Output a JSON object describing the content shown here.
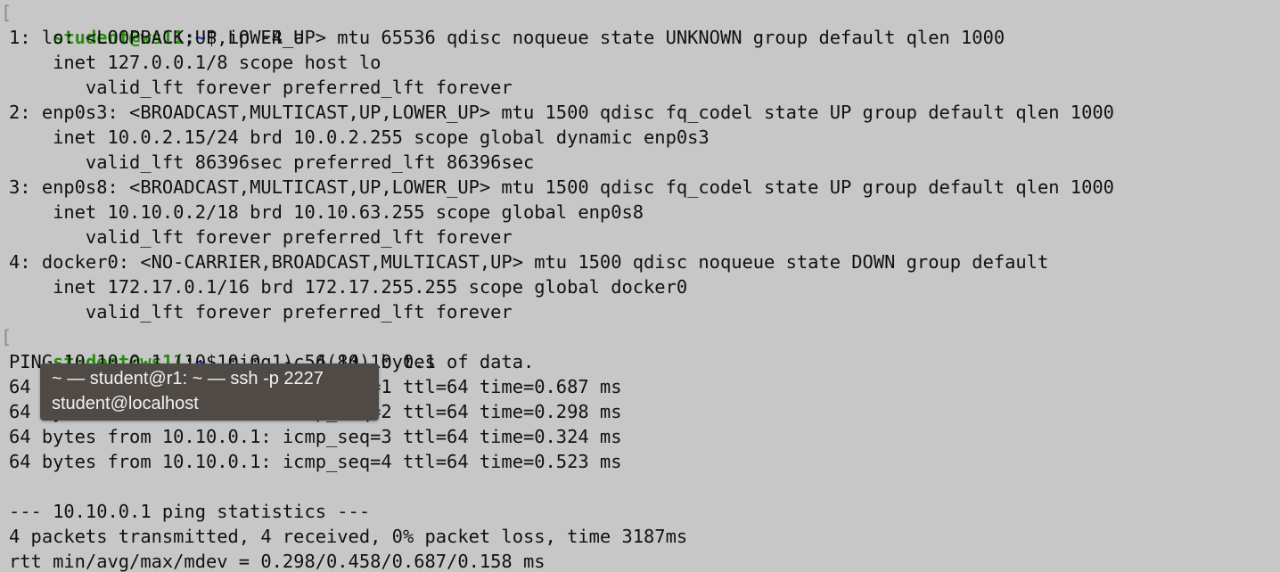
{
  "prompt": {
    "bracket": "[",
    "user": "student@ws11",
    "sep": ":",
    "path": "~",
    "dollar": "$"
  },
  "commands": {
    "first": "ip -4 a",
    "second": "ping -c 4 10.10.0.1"
  },
  "ip_output": [
    "1: lo: <LOOPBACK,UP,LOWER_UP> mtu 65536 qdisc noqueue state UNKNOWN group default qlen 1000",
    "    inet 127.0.0.1/8 scope host lo",
    "       valid_lft forever preferred_lft forever",
    "2: enp0s3: <BROADCAST,MULTICAST,UP,LOWER_UP> mtu 1500 qdisc fq_codel state UP group default qlen 1000",
    "    inet 10.0.2.15/24 brd 10.0.2.255 scope global dynamic enp0s3",
    "       valid_lft 86396sec preferred_lft 86396sec",
    "3: enp0s8: <BROADCAST,MULTICAST,UP,LOWER_UP> mtu 1500 qdisc fq_codel state UP group default qlen 1000",
    "    inet 10.10.0.2/18 brd 10.10.63.255 scope global enp0s8",
    "       valid_lft forever preferred_lft forever",
    "4: docker0: <NO-CARRIER,BROADCAST,MULTICAST,UP> mtu 1500 qdisc noqueue state DOWN group default",
    "    inet 172.17.0.1/16 brd 172.17.255.255 scope global docker0",
    "       valid_lft forever preferred_lft forever"
  ],
  "ping_output": [
    "PING 10.10.0.1 (10.10.0.1) 56(84) bytes of data.",
    "64 bytes from 10.10.0.1: icmp_seq=1 ttl=64 time=0.687 ms",
    "64 bytes from 10.10.0.1: icmp_seq=2 ttl=64 time=0.298 ms",
    "64 bytes from 10.10.0.1: icmp_seq=3 ttl=64 time=0.324 ms",
    "64 bytes from 10.10.0.1: icmp_seq=4 ttl=64 time=0.523 ms",
    "",
    "--- 10.10.0.1 ping statistics ---",
    "4 packets transmitted, 4 received, 0% packet loss, time 3187ms",
    "rtt min/avg/max/mdev = 0.298/0.458/0.687/0.158 ms"
  ],
  "tooltip": {
    "line1": "~ — student@r1: ~ — ssh -p 2227",
    "line2": "student@localhost"
  },
  "colors": {
    "background": "#c7c7c8",
    "text": "#111111",
    "user": "#2a8a0e",
    "path": "#2440c4",
    "tooltip_bg": "#4f4a46",
    "tooltip_text": "#f2f2f2"
  }
}
